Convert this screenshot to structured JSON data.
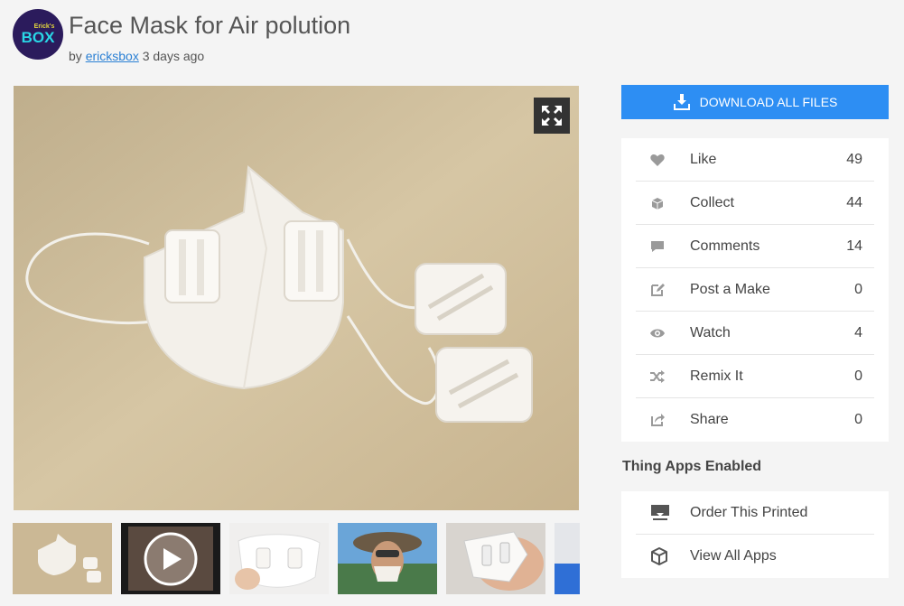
{
  "header": {
    "avatar_small": "Erick's",
    "avatar_big": "BOX",
    "title": "Face Mask for Air polution",
    "by_label": "by",
    "author": "ericksbox",
    "time_ago": "3 days ago"
  },
  "download": {
    "label": "DOWNLOAD ALL FILES"
  },
  "stats": [
    {
      "label": "Like",
      "count": "49",
      "icon": "heart-icon"
    },
    {
      "label": "Collect",
      "count": "44",
      "icon": "collect-icon"
    },
    {
      "label": "Comments",
      "count": "14",
      "icon": "comment-icon"
    },
    {
      "label": "Post a Make",
      "count": "0",
      "icon": "edit-icon"
    },
    {
      "label": "Watch",
      "count": "4",
      "icon": "eye-icon"
    },
    {
      "label": "Remix It",
      "count": "0",
      "icon": "shuffle-icon"
    },
    {
      "label": "Share",
      "count": "0",
      "icon": "share-icon"
    }
  ],
  "apps": {
    "title": "Thing Apps Enabled",
    "items": [
      {
        "label": "Order This Printed",
        "icon": "printer-icon"
      },
      {
        "label": "View All Apps",
        "icon": "cube-icon"
      }
    ]
  },
  "colors": {
    "accent": "#2d8ef3",
    "link": "#2b80d4",
    "icon": "#999999"
  }
}
